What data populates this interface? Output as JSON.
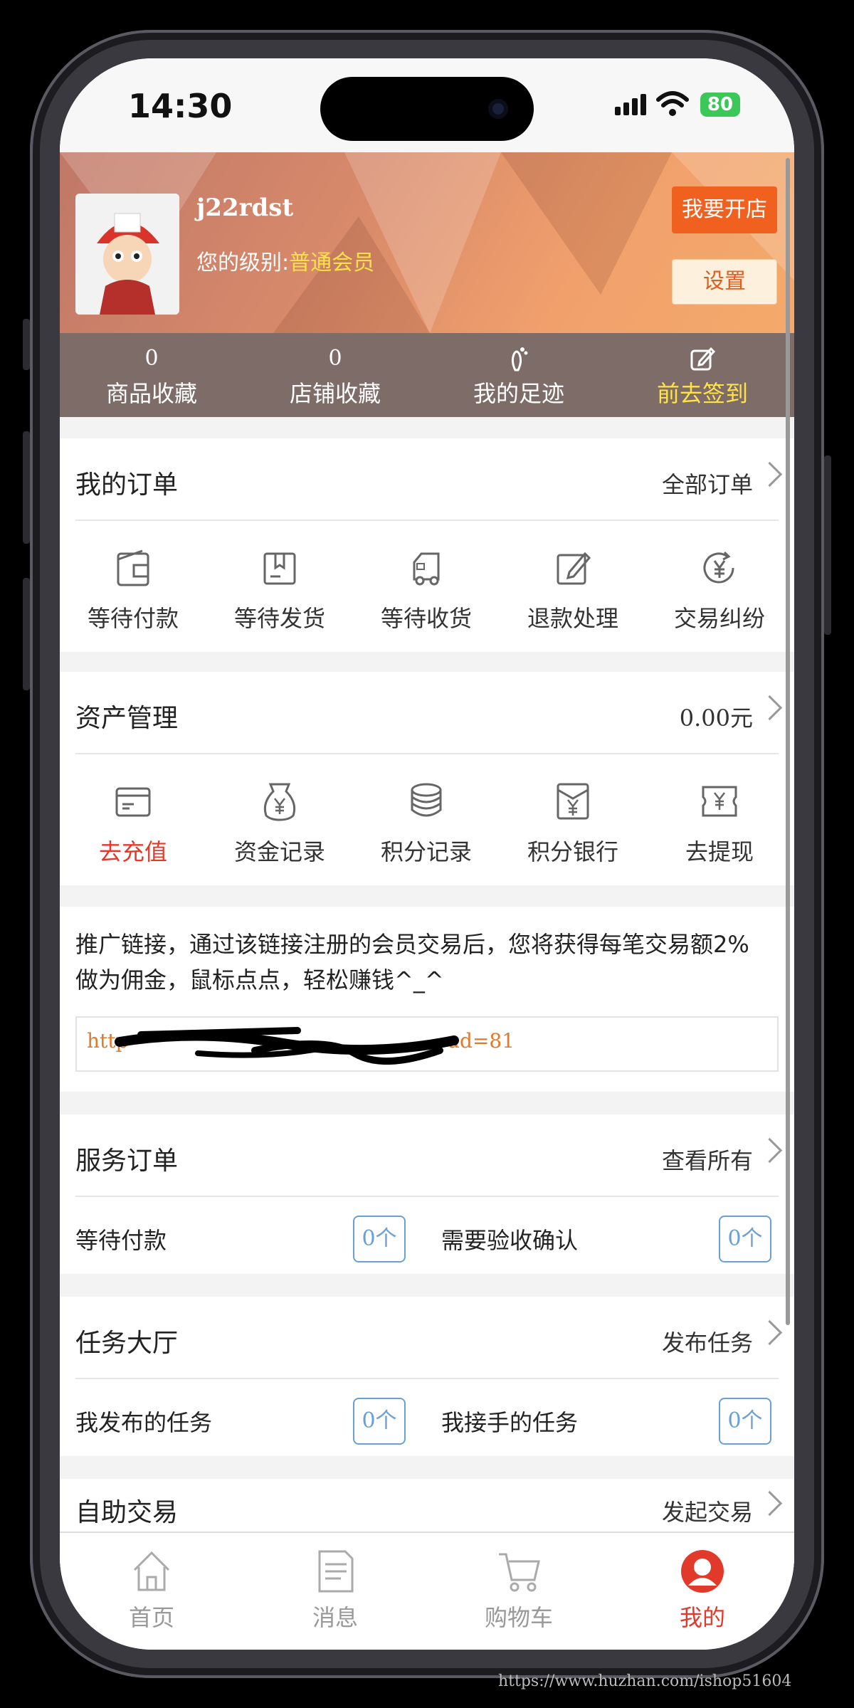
{
  "status_bar": {
    "time": "14:30",
    "battery": "80"
  },
  "profile": {
    "username": "j22rdst",
    "level_label": "您的级别:",
    "level_value": "普通会员",
    "open_shop_button": "我要开店",
    "settings_button": "设置"
  },
  "stats": [
    {
      "value": "0",
      "label": "商品收藏",
      "icon": ""
    },
    {
      "value": "0",
      "label": "店铺收藏",
      "icon": ""
    },
    {
      "value": "",
      "label": "我的足迹",
      "icon": "footprint-icon"
    },
    {
      "value": "",
      "label": "前去签到",
      "icon": "edit-icon"
    }
  ],
  "orders": {
    "title": "我的订单",
    "more": "全部订单",
    "items": [
      {
        "label": "等待付款",
        "icon": "wallet-icon"
      },
      {
        "label": "等待发货",
        "icon": "package-icon"
      },
      {
        "label": "等待收货",
        "icon": "truck-icon"
      },
      {
        "label": "退款处理",
        "icon": "edit-icon"
      },
      {
        "label": "交易纠纷",
        "icon": "yen-refresh-icon"
      }
    ]
  },
  "assets": {
    "title": "资产管理",
    "more": "0.00元",
    "items": [
      {
        "label": "去充值",
        "icon": "card-icon",
        "highlight": true
      },
      {
        "label": "资金记录",
        "icon": "money-bag-icon"
      },
      {
        "label": "积分记录",
        "icon": "coins-stack-icon"
      },
      {
        "label": "积分银行",
        "icon": "yen-envelope-icon"
      },
      {
        "label": "去提现",
        "icon": "yen-ticket-icon"
      }
    ]
  },
  "promo": {
    "text": "推广链接，通过该链接注册的会员交易后，您将获得每笔交易额2%做为佣金，鼠标点点，轻松赚钱^_^",
    "link_visible_start": "http",
    "link_visible_end": "ud=81"
  },
  "service_orders": {
    "title": "服务订单",
    "more": "查看所有",
    "items": [
      {
        "label": "等待付款",
        "count": "0个"
      },
      {
        "label": "需要验收确认",
        "count": "0个"
      }
    ]
  },
  "task_hall": {
    "title": "任务大厅",
    "more": "发布任务",
    "items": [
      {
        "label": "我发布的任务",
        "count": "0个"
      },
      {
        "label": "我接手的任务",
        "count": "0个"
      }
    ]
  },
  "self_trade": {
    "title": "自助交易",
    "more": "发起交易"
  },
  "tabbar": [
    {
      "label": "首页",
      "icon": "home-icon"
    },
    {
      "label": "消息",
      "icon": "message-icon"
    },
    {
      "label": "购物车",
      "icon": "cart-icon"
    },
    {
      "label": "我的",
      "icon": "user-icon",
      "active": true
    }
  ],
  "watermark": "https://www.huzhan.com/ishop51604",
  "colors": {
    "accent": "#e23a2a",
    "orange": "#f0601e",
    "gold": "#ffe24a",
    "badge": "#6aa0d6"
  }
}
